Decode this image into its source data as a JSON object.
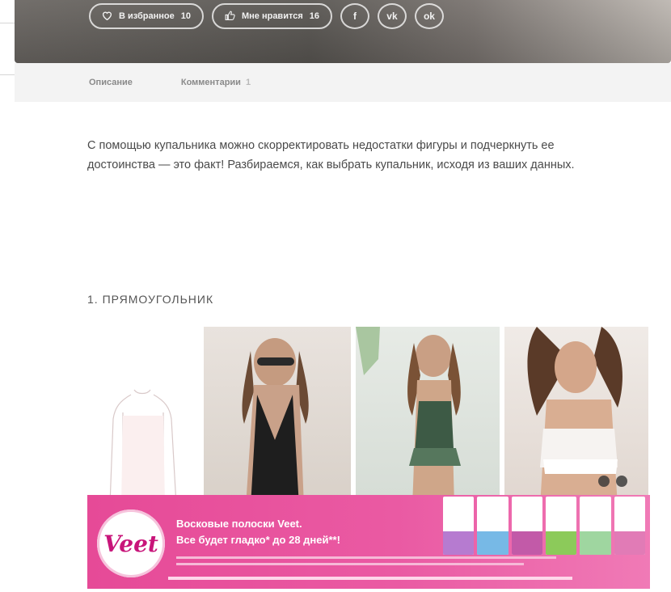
{
  "hero": {
    "favorite_label": "В избранное",
    "favorite_count": "10",
    "like_label": "Мне нравится",
    "like_count": "16",
    "share_fb": "f",
    "share_vk": "vk",
    "share_ok": "ok"
  },
  "tabs": [
    {
      "label": "Описание"
    },
    {
      "label": "Комментарии",
      "badge": "1"
    }
  ],
  "article": {
    "intro": "С помощью купальника можно скорректировать недостатки фигуры и подчеркнуть ее достоинства — это факт! Разбираемся, как выбрать купальник, исходя из ваших данных.",
    "section_1_title": "1. ПРЯМОУГОЛЬНИК"
  },
  "ad": {
    "brand": "Veet",
    "headline_1": "Восковые полоски Veet.",
    "headline_2": "Все будет гладко* до 28 дней**!"
  },
  "colors": {
    "accent_pink": "#e64a97",
    "tab_bg": "#f3f3f3"
  }
}
